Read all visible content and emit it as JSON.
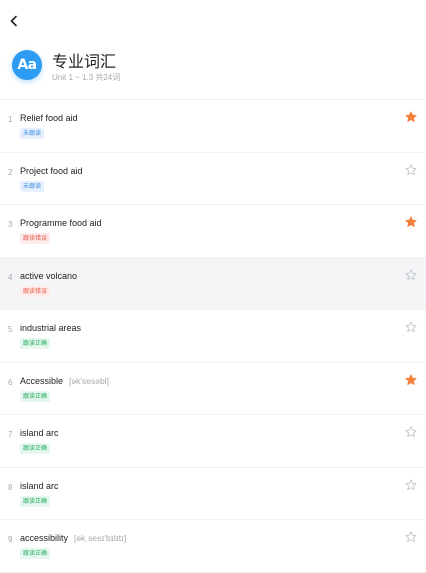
{
  "header": {
    "logo_text": "Aa",
    "title": "专业词汇",
    "subtitle": "Unit 1 ~ 1.3 共24词"
  },
  "colors": {
    "accent": "#2d9cf2",
    "star_on": "#f5803e",
    "star_off": "#b8bcc2"
  },
  "words": [
    {
      "index": "1",
      "word": "Relief food aid",
      "phonetic": "",
      "status": "未跟读",
      "status_type": "blue",
      "starred": true
    },
    {
      "index": "2",
      "word": "Project food aid",
      "phonetic": "",
      "status": "未跟读",
      "status_type": "blue",
      "starred": false
    },
    {
      "index": "3",
      "word": "Programme food aid",
      "phonetic": "",
      "status": "跟读错误",
      "status_type": "red",
      "starred": true
    },
    {
      "index": "4",
      "word": "active volcano",
      "phonetic": "",
      "status": "跟读错误",
      "status_type": "red",
      "starred": false
    },
    {
      "index": "5",
      "word": "industrial areas",
      "phonetic": "",
      "status": "跟读正确",
      "status_type": "green",
      "starred": false
    },
    {
      "index": "6",
      "word": "Accessible",
      "phonetic": "[ək'sesəbl]",
      "status": "跟读正确",
      "status_type": "green",
      "starred": true
    },
    {
      "index": "7",
      "word": "island arc",
      "phonetic": "",
      "status": "跟读正确",
      "status_type": "green",
      "starred": false
    },
    {
      "index": "8",
      "word": "island arc",
      "phonetic": "",
      "status": "跟读正确",
      "status_type": "green",
      "starred": false
    },
    {
      "index": "9",
      "word": "accessibility",
      "phonetic": "[əkˌsesɪ'bɪlɪtɪ]",
      "status": "跟读正确",
      "status_type": "green",
      "starred": false
    }
  ],
  "selected_index": 3
}
